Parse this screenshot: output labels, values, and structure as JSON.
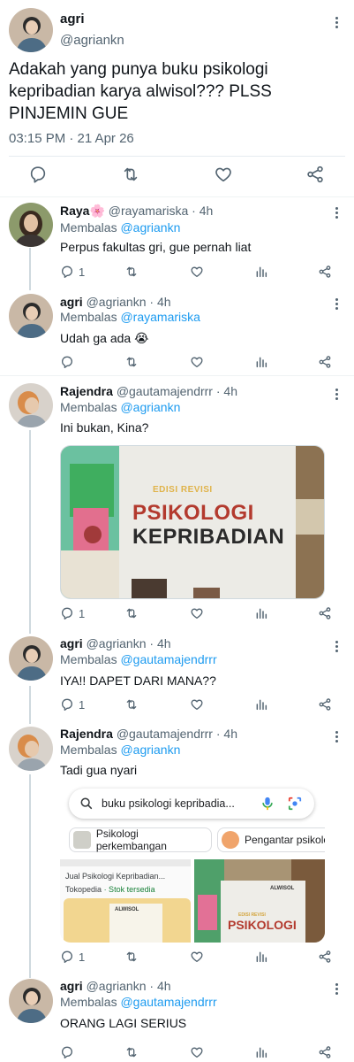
{
  "main_tweet": {
    "name": "agri",
    "handle": "@agriankn",
    "text": "Adakah yang punya buku psikologi kepribadian karya alwisol??? PLSS PINJEMIN GUE",
    "timestamp": "03:15 PM · 21 Apr 26"
  },
  "replies": [
    {
      "name": "Raya🌸",
      "handle": "@rayamariska",
      "time": "· 4h",
      "replying_prefix": "Membalas ",
      "replying_to": "@agriankn",
      "text": "Perpus fakultas gri, gue pernah liat",
      "reply_count": "1"
    },
    {
      "name": "agri",
      "handle": "@agriankn",
      "time": "· 4h",
      "replying_prefix": "Membalas ",
      "replying_to": "@rayamariska",
      "text": "Udah ga ada 😭",
      "reply_count": ""
    },
    {
      "name": "Rajendra",
      "handle": "@gautamajendrrr",
      "time": "· 4h",
      "replying_prefix": "Membalas ",
      "replying_to": "@agriankn",
      "text": "Ini bukan, Kina?",
      "reply_count": "1",
      "book_edition": "EDISI REVISI",
      "book_title_1": "PSIKOLOGI",
      "book_title_2": "KEPRIBADIAN"
    },
    {
      "name": "agri",
      "handle": "@agriankn",
      "time": "· 4h",
      "replying_prefix": "Membalas ",
      "replying_to": "@gautamajendrrr",
      "text": "IYA!! DAPET DARI MANA??",
      "reply_count": "1"
    },
    {
      "name": "Rajendra",
      "handle": "@gautamajendrrr",
      "time": "· 4h",
      "replying_prefix": "Membalas ",
      "replying_to": "@agriankn",
      "text": "Tadi gua nyari",
      "reply_count": "1",
      "search_query": "buku psikologi kepribadia...",
      "chip_1": "Psikologi perkembangan",
      "chip_2": "Pengantar psikolo",
      "result_title": "Jual Psikologi Kepribadian...",
      "result_source": "Tokopedia",
      "result_stock": "· Stok tersedia",
      "result_book_author": "ALWISOL",
      "result_book_edition": "EDISI REVISI",
      "result_book_title": "PSIKOLOGI"
    },
    {
      "name": "agri",
      "handle": "@agriankn",
      "time": "· 4h",
      "replying_prefix": "Membalas ",
      "replying_to": "@gautamajendrrr",
      "text": "ORANG LAGI SERIUS",
      "reply_count": ""
    }
  ],
  "icons": {
    "reply": "reply-icon",
    "retweet": "retweet-icon",
    "like": "heart-icon",
    "views": "views-icon",
    "share": "share-icon",
    "more": "more-icon"
  },
  "colors": {
    "link": "#1d9bf0",
    "secondary": "#536471"
  }
}
